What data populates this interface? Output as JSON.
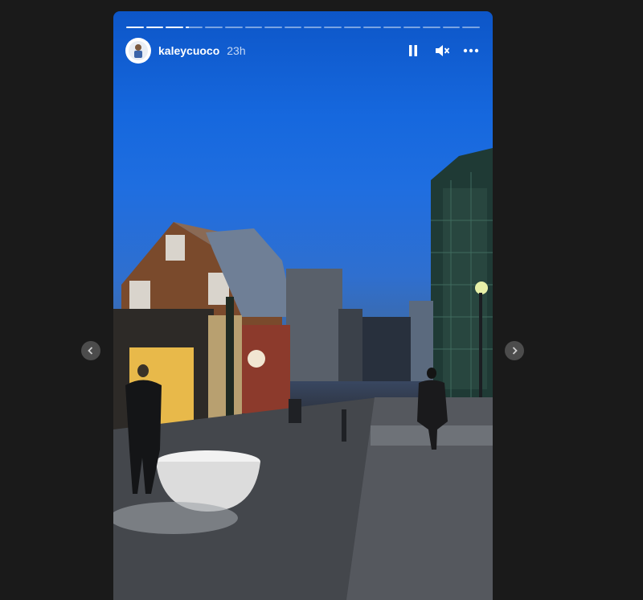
{
  "story": {
    "username": "kaleycuoco",
    "time_ago": "23h",
    "progress": {
      "segments": 18,
      "completed": 3,
      "current_fraction": 0.2
    }
  },
  "controls": {
    "pause_icon": "pause-icon",
    "mute_icon": "muted-speaker-icon",
    "more_icon": "ellipsis-icon"
  },
  "navigation": {
    "prev_icon": "chevron-left-icon",
    "next_icon": "chevron-right-icon"
  },
  "colors": {
    "background": "#1a1a1a",
    "sky_top": "#0d56c8",
    "sky_bottom": "#3d6aa7"
  }
}
